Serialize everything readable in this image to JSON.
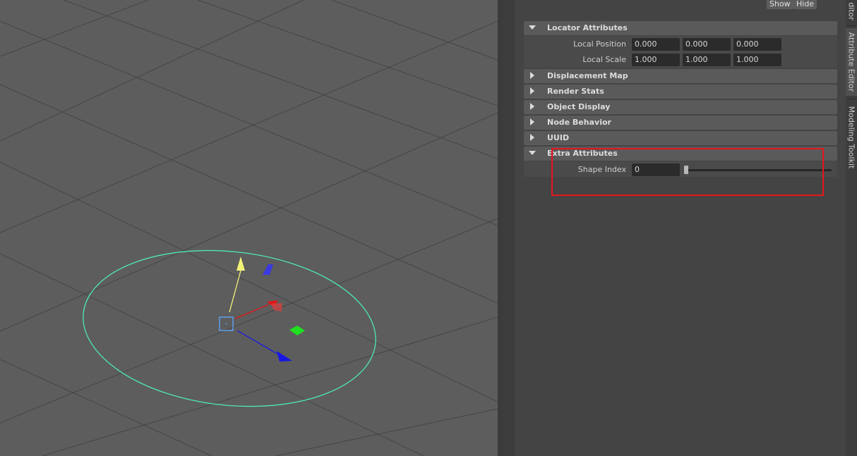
{
  "viewport": {
    "gizmo_colors": {
      "ring": "#4fe8b4",
      "x_axis": "#e01818",
      "y_axis": "#f2f278",
      "z_axis": "#1818e6",
      "xz_plane": "#20e020",
      "center": "#5fa8ff"
    }
  },
  "panel": {
    "top_buttons": {
      "show": "Show",
      "hide": "Hide"
    },
    "sections": [
      {
        "title": "Locator Attributes",
        "expanded": true
      },
      {
        "title": "Displacement Map",
        "expanded": false
      },
      {
        "title": "Render Stats",
        "expanded": false
      },
      {
        "title": "Object Display",
        "expanded": false
      },
      {
        "title": "Node Behavior",
        "expanded": false
      },
      {
        "title": "UUID",
        "expanded": false
      },
      {
        "title": "Extra Attributes",
        "expanded": true
      }
    ],
    "locator": {
      "local_position": {
        "label": "Local Position",
        "values": [
          "0.000",
          "0.000",
          "0.000"
        ]
      },
      "local_scale": {
        "label": "Local Scale",
        "values": [
          "1.000",
          "1.000",
          "1.000"
        ]
      }
    },
    "extra": {
      "shape_index": {
        "label": "Shape Index",
        "value": "0",
        "slider_fraction": 0.0
      }
    }
  },
  "side_tabs": {
    "partial": "ditor",
    "attribute_editor": "Attribute Editor",
    "modeling_toolkit": "Modeling Toolkit"
  },
  "highlight_color": "#e5161c"
}
